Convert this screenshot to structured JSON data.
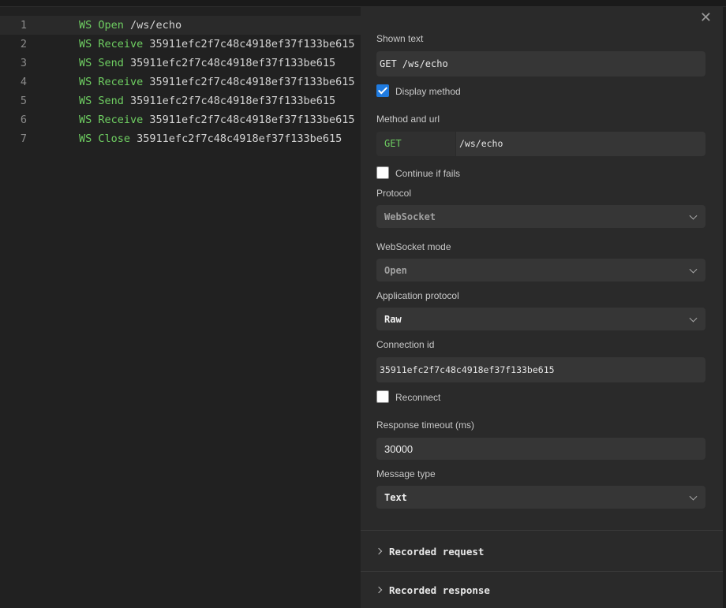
{
  "editor": {
    "lines": [
      {
        "num": "1",
        "kw": "WS Open",
        "arg": "/ws/echo"
      },
      {
        "num": "2",
        "kw": "WS Receive",
        "arg": "35911efc2f7c48c4918ef37f133be615"
      },
      {
        "num": "3",
        "kw": "WS Send",
        "arg": "35911efc2f7c48c4918ef37f133be615"
      },
      {
        "num": "4",
        "kw": "WS Receive",
        "arg": "35911efc2f7c48c4918ef37f133be615"
      },
      {
        "num": "5",
        "kw": "WS Send",
        "arg": "35911efc2f7c48c4918ef37f133be615"
      },
      {
        "num": "6",
        "kw": "WS Receive",
        "arg": "35911efc2f7c48c4918ef37f133be615"
      },
      {
        "num": "7",
        "kw": "WS Close",
        "arg": "35911efc2f7c48c4918ef37f133be615"
      }
    ]
  },
  "panel": {
    "close_glyph": "✕",
    "shown_text_label": "Shown text",
    "shown_text_value": "GET /ws/echo",
    "display_method_label": "Display method",
    "display_method_checked": true,
    "method_url_label": "Method and url",
    "method": "GET",
    "url": "/ws/echo",
    "continue_label": "Continue if fails",
    "continue_checked": false,
    "protocol_label": "Protocol",
    "protocol_value": "WebSocket",
    "ws_mode_label": "WebSocket mode",
    "ws_mode_value": "Open",
    "app_protocol_label": "Application protocol",
    "app_protocol_value": "Raw",
    "connection_id_label": "Connection id",
    "connection_id_value": "35911efc2f7c48c4918ef37f133be615",
    "reconnect_label": "Reconnect",
    "reconnect_checked": false,
    "timeout_label": "Response timeout (ms)",
    "timeout_value": "30000",
    "message_type_label": "Message type",
    "message_type_value": "Text",
    "recorded_request_label": "Recorded request",
    "recorded_response_label": "Recorded response"
  },
  "colors": {
    "keyword": "#6fcf62",
    "checkbox_checked": "#1f7be0",
    "panel_bg": "#2a2a2a",
    "editor_bg": "#212121"
  }
}
